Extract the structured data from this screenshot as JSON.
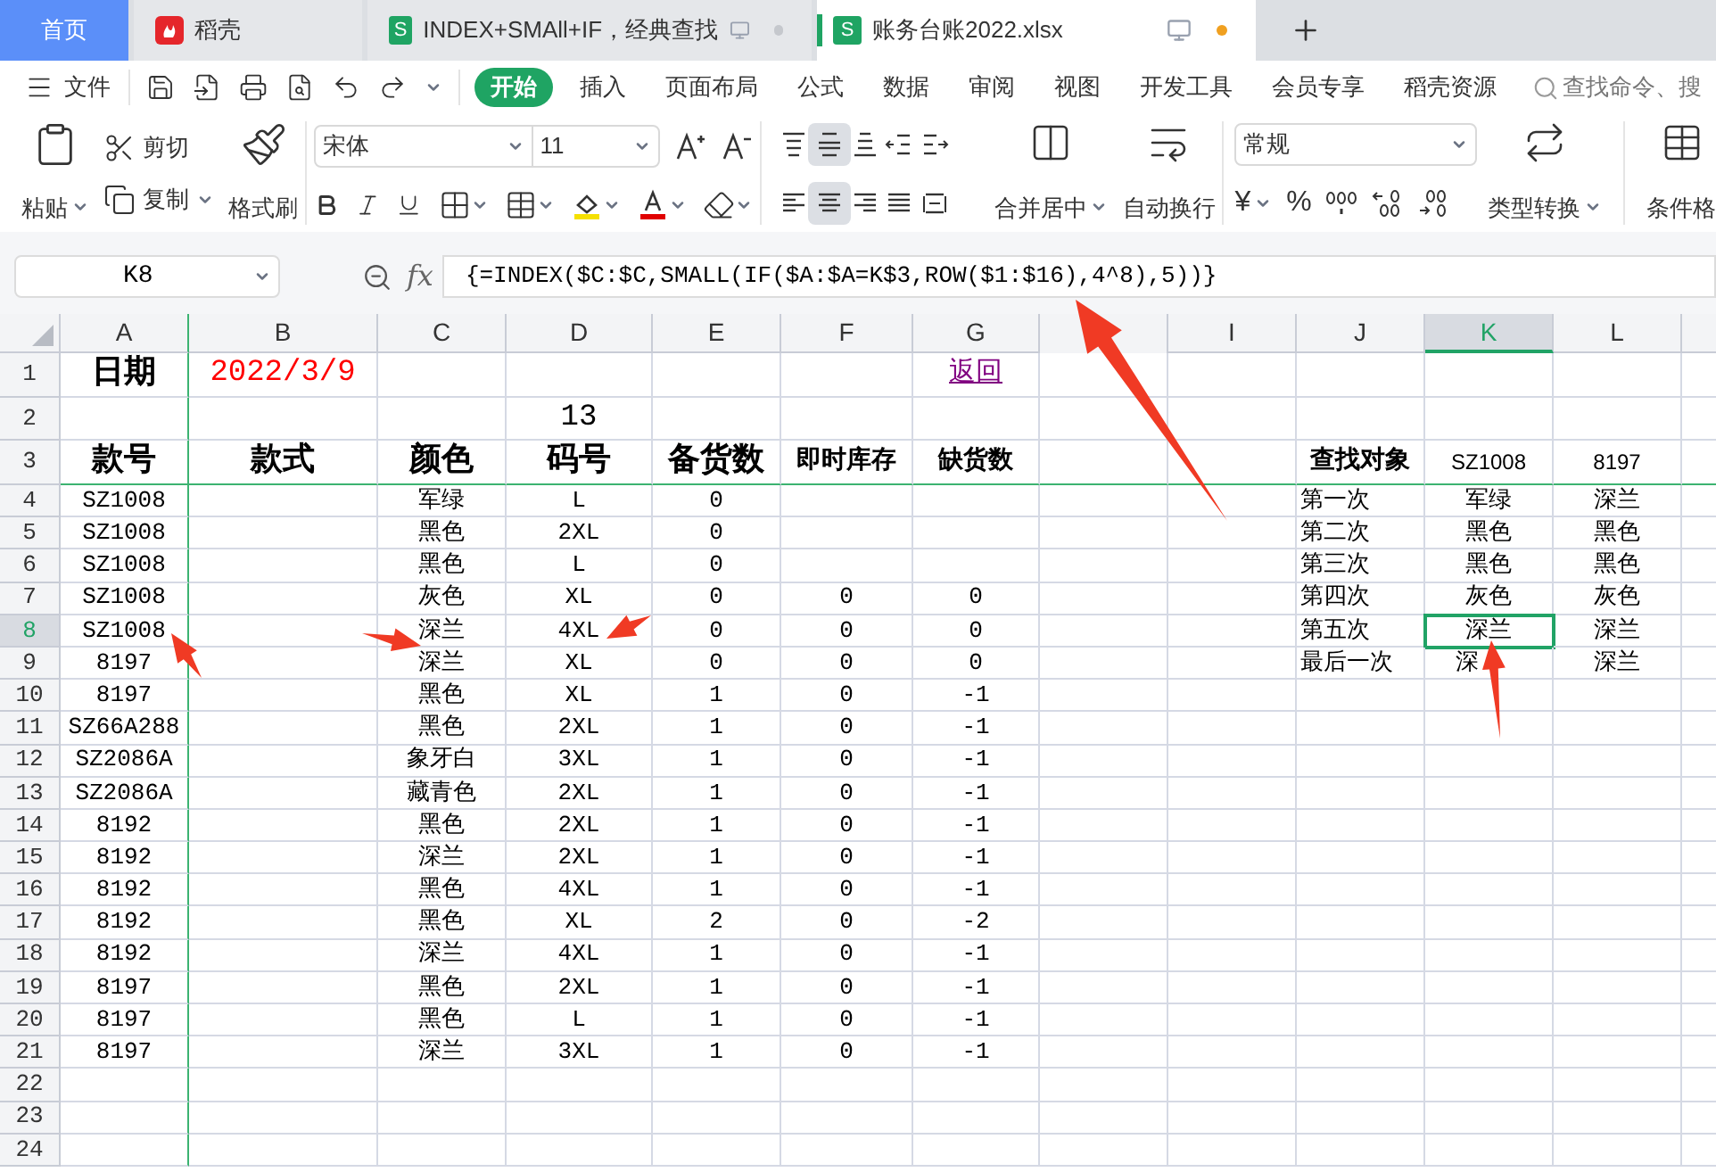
{
  "tabs": [
    {
      "label": "首页",
      "kind": "home",
      "selected": false
    },
    {
      "label": "稻壳",
      "kind": "app",
      "selected": false
    },
    {
      "label": "INDEX+SMAll+IF，经典查找",
      "kind": "doc",
      "badge": "S",
      "modified": false,
      "selected": false
    },
    {
      "label": "账务台账2022.xlsx",
      "kind": "doc",
      "badge": "S",
      "modified": true,
      "selected": true
    }
  ],
  "menu": {
    "file": "文件",
    "items": [
      {
        "label": "开始",
        "selected": true
      },
      {
        "label": "插入",
        "selected": false
      },
      {
        "label": "页面布局",
        "selected": false
      },
      {
        "label": "公式",
        "selected": false
      },
      {
        "label": "数据",
        "selected": false
      },
      {
        "label": "审阅",
        "selected": false
      },
      {
        "label": "视图",
        "selected": false
      },
      {
        "label": "开发工具",
        "selected": false
      },
      {
        "label": "会员专享",
        "selected": false
      },
      {
        "label": "稻壳资源",
        "selected": false
      }
    ],
    "search_placeholder": "查找命令、搜"
  },
  "toolbar": {
    "paste": "粘贴",
    "cut": "剪切",
    "copy": "复制",
    "format_painter": "格式刷",
    "font": "宋体",
    "font_size": "11",
    "merge": "合并居中",
    "wrap": "自动换行",
    "number_format": "常规",
    "currency": "¥",
    "percent": "%",
    "convert": "类型转换",
    "conditional": "条件格",
    "alignment_buttons": [
      {
        "kind": "top",
        "selected": false
      },
      {
        "kind": "middle",
        "selected": true
      },
      {
        "kind": "bottom",
        "selected": false
      },
      {
        "kind": "outdent",
        "selected": false
      },
      {
        "kind": "indent",
        "selected": false
      },
      {
        "kind": "left",
        "selected": false
      },
      {
        "kind": "center",
        "selected": true
      },
      {
        "kind": "right",
        "selected": false
      },
      {
        "kind": "justify",
        "selected": false
      },
      {
        "kind": "distributed",
        "selected": false
      }
    ]
  },
  "formula_bar": {
    "cell": "K8",
    "function_label": "fx",
    "formula": "{=INDEX($C:$C,SMALL(IF($A:$A=K$3,ROW($1:$16),4^8),5))}"
  },
  "columns": [
    {
      "label": "A",
      "selected": false
    },
    {
      "label": "B",
      "selected": false
    },
    {
      "label": "C",
      "selected": false
    },
    {
      "label": "D",
      "selected": false
    },
    {
      "label": "E",
      "selected": false
    },
    {
      "label": "F",
      "selected": false
    },
    {
      "label": "G",
      "selected": false
    },
    {
      "selected": false
    },
    {
      "label": "I",
      "selected": false
    },
    {
      "label": "J",
      "selected": false
    },
    {
      "label": "K",
      "selected": true
    },
    {
      "label": "L",
      "selected": false
    }
  ],
  "rows": [
    {
      "number": "1",
      "kind": "tall",
      "selected": false,
      "cells": [
        {
          "text": "日期",
          "kind": "heading"
        },
        {
          "text": "2022/3/9",
          "kind": "red"
        },
        null,
        null,
        null,
        null,
        {
          "text": "返回",
          "kind": "link"
        },
        null,
        null,
        null,
        null,
        null
      ]
    },
    {
      "number": "2",
      "kind": "tall",
      "selected": false,
      "cells": [
        null,
        null,
        null,
        "13",
        null,
        null,
        null,
        null,
        null,
        null,
        null,
        null
      ]
    },
    {
      "number": "3",
      "kind": "tall",
      "selected": false,
      "cells": [
        {
          "text": "款号",
          "kind": "heading"
        },
        {
          "text": "款式",
          "kind": "heading"
        },
        {
          "text": "颜色",
          "kind": "heading"
        },
        {
          "text": "码号",
          "kind": "heading"
        },
        {
          "text": "备货数",
          "kind": "heading"
        },
        {
          "text": "即时库存",
          "kind": "label"
        },
        {
          "text": "缺货数",
          "kind": "label"
        },
        null,
        null,
        {
          "text": "查找对象",
          "kind": "label"
        },
        {
          "text": "SZ1008",
          "kind": "sans"
        },
        {
          "text": "8197",
          "kind": "sans"
        }
      ]
    },
    {
      "number": "4",
      "kind": "normal",
      "selected": false,
      "cells": [
        "SZ1008",
        null,
        "军绿",
        "L",
        "0",
        null,
        null,
        null,
        null,
        {
          "text": "第一次",
          "kind": "left"
        },
        "军绿",
        "深兰"
      ]
    },
    {
      "number": "5",
      "kind": "normal",
      "selected": false,
      "cells": [
        "SZ1008",
        null,
        "黑色",
        "2XL",
        "0",
        null,
        null,
        null,
        null,
        {
          "text": "第二次",
          "kind": "left"
        },
        "黑色",
        "黑色"
      ]
    },
    {
      "number": "6",
      "kind": "normal",
      "selected": false,
      "cells": [
        "SZ1008",
        null,
        "黑色",
        "L",
        "0",
        null,
        null,
        null,
        null,
        {
          "text": "第三次",
          "kind": "left"
        },
        "黑色",
        "黑色"
      ]
    },
    {
      "number": "7",
      "kind": "normal",
      "selected": false,
      "cells": [
        "SZ1008",
        null,
        "灰色",
        "XL",
        "0",
        "0",
        "0",
        null,
        null,
        {
          "text": "第四次",
          "kind": "left"
        },
        "灰色",
        "灰色"
      ]
    },
    {
      "number": "8",
      "kind": "normal",
      "selected": true,
      "cells": [
        "SZ1008",
        null,
        "深兰",
        "4XL",
        "0",
        "0",
        "0",
        null,
        null,
        {
          "text": "第五次",
          "kind": "left"
        },
        "深兰",
        "深兰"
      ]
    },
    {
      "number": "9",
      "kind": "normal",
      "selected": false,
      "cells": [
        "8197",
        null,
        "深兰",
        "XL",
        "0",
        "0",
        "0",
        null,
        null,
        {
          "text": "最后一次",
          "kind": "left"
        },
        {
          "text": "深",
          "kind": "partial"
        },
        "深兰"
      ]
    },
    {
      "number": "10",
      "kind": "normal",
      "selected": false,
      "cells": [
        "8197",
        null,
        "黑色",
        "XL",
        "1",
        "0",
        "-1",
        null,
        null,
        null,
        null,
        null
      ]
    },
    {
      "number": "11",
      "kind": "normal",
      "selected": false,
      "cells": [
        "SZ66A288",
        null,
        "黑色",
        "2XL",
        "1",
        "0",
        "-1",
        null,
        null,
        null,
        null,
        null
      ]
    },
    {
      "number": "12",
      "kind": "normal",
      "selected": false,
      "cells": [
        "SZ2086A",
        null,
        "象牙白",
        "3XL",
        "1",
        "0",
        "-1",
        null,
        null,
        null,
        null,
        null
      ]
    },
    {
      "number": "13",
      "kind": "normal",
      "selected": false,
      "cells": [
        "SZ2086A",
        null,
        "藏青色",
        "2XL",
        "1",
        "0",
        "-1",
        null,
        null,
        null,
        null,
        null
      ]
    },
    {
      "number": "14",
      "kind": "normal",
      "selected": false,
      "cells": [
        "8192",
        null,
        "黑色",
        "2XL",
        "1",
        "0",
        "-1",
        null,
        null,
        null,
        null,
        null
      ]
    },
    {
      "number": "15",
      "kind": "normal",
      "selected": false,
      "cells": [
        "8192",
        null,
        "深兰",
        "2XL",
        "1",
        "0",
        "-1",
        null,
        null,
        null,
        null,
        null
      ]
    },
    {
      "number": "16",
      "kind": "normal",
      "selected": false,
      "cells": [
        "8192",
        null,
        "黑色",
        "4XL",
        "1",
        "0",
        "-1",
        null,
        null,
        null,
        null,
        null
      ]
    },
    {
      "number": "17",
      "kind": "normal",
      "selected": false,
      "cells": [
        "8192",
        null,
        "黑色",
        "XL",
        "2",
        "0",
        "-2",
        null,
        null,
        null,
        null,
        null
      ]
    },
    {
      "number": "18",
      "kind": "normal",
      "selected": false,
      "cells": [
        "8192",
        null,
        "深兰",
        "4XL",
        "1",
        "0",
        "-1",
        null,
        null,
        null,
        null,
        null
      ]
    },
    {
      "number": "19",
      "kind": "normal",
      "selected": false,
      "cells": [
        "8197",
        null,
        "黑色",
        "2XL",
        "1",
        "0",
        "-1",
        null,
        null,
        null,
        null,
        null
      ]
    },
    {
      "number": "20",
      "kind": "normal",
      "selected": false,
      "cells": [
        "8197",
        null,
        "黑色",
        "L",
        "1",
        "0",
        "-1",
        null,
        null,
        null,
        null,
        null
      ]
    },
    {
      "number": "21",
      "kind": "normal",
      "selected": false,
      "cells": [
        "8197",
        null,
        "深兰",
        "3XL",
        "1",
        "0",
        "-1",
        null,
        null,
        null,
        null,
        null
      ]
    },
    {
      "number": "22",
      "kind": "normal",
      "selected": false,
      "cells": [
        null,
        null,
        null,
        null,
        null,
        null,
        null,
        null,
        null,
        null,
        null,
        null
      ]
    },
    {
      "number": "23",
      "kind": "normal",
      "selected": false,
      "cells": [
        null,
        null,
        null,
        null,
        null,
        null,
        null,
        null,
        null,
        null,
        null,
        null
      ]
    },
    {
      "number": "24",
      "kind": "normal",
      "selected": false,
      "cells": [
        null,
        null,
        null,
        null,
        null,
        null,
        null,
        null,
        null,
        null,
        null,
        null
      ]
    }
  ]
}
